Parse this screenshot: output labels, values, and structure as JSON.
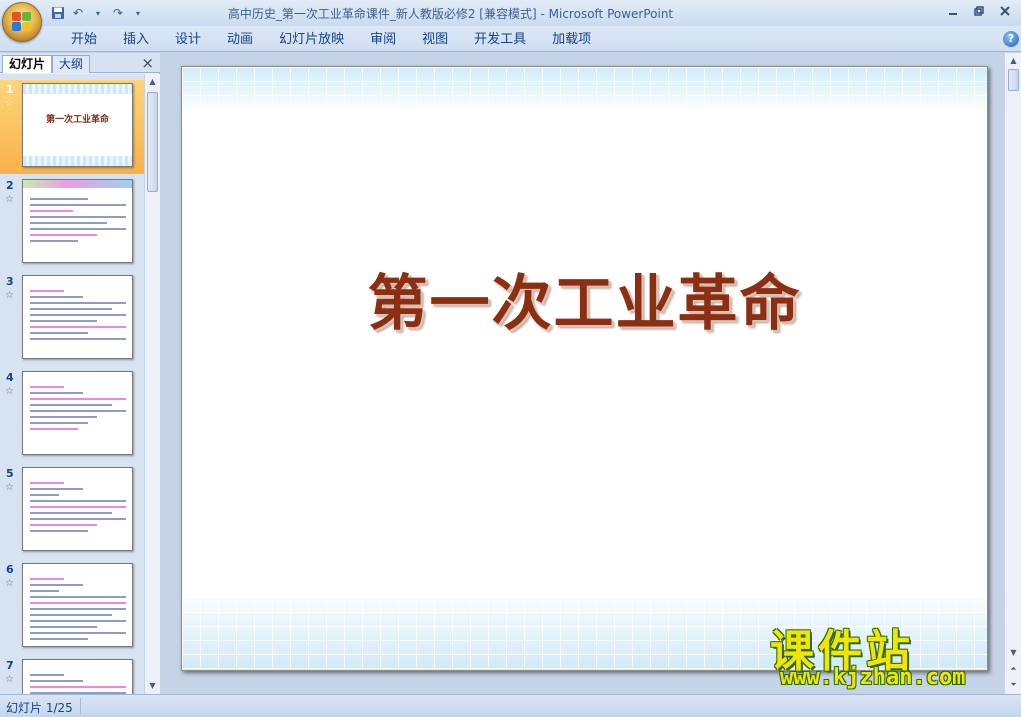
{
  "window": {
    "title_doc": "高中历史_第一次工业革命课件_新人教版必修2 [兼容模式]",
    "title_sep": " - ",
    "title_app": "Microsoft PowerPoint"
  },
  "menu": {
    "tabs": [
      "开始",
      "插入",
      "设计",
      "动画",
      "幻灯片放映",
      "审阅",
      "视图",
      "开发工具",
      "加载项"
    ]
  },
  "panel": {
    "tab_slides": "幻灯片",
    "tab_outline": "大纲",
    "close_glyph": "×"
  },
  "thumbnails": [
    {
      "num": "1",
      "title": "第一次工业革命"
    },
    {
      "num": "2"
    },
    {
      "num": "3"
    },
    {
      "num": "4"
    },
    {
      "num": "5"
    },
    {
      "num": "6"
    },
    {
      "num": "7"
    }
  ],
  "slide": {
    "title": "第一次工业革命"
  },
  "watermark": {
    "line1": "课件站",
    "line2": "www.kjzhan.com"
  },
  "status": {
    "text": "幻灯片 1/25"
  },
  "colors": {
    "selected_thumb": "#f8b14a",
    "title_text": "#8b2e12",
    "watermark": "#f2e600"
  }
}
